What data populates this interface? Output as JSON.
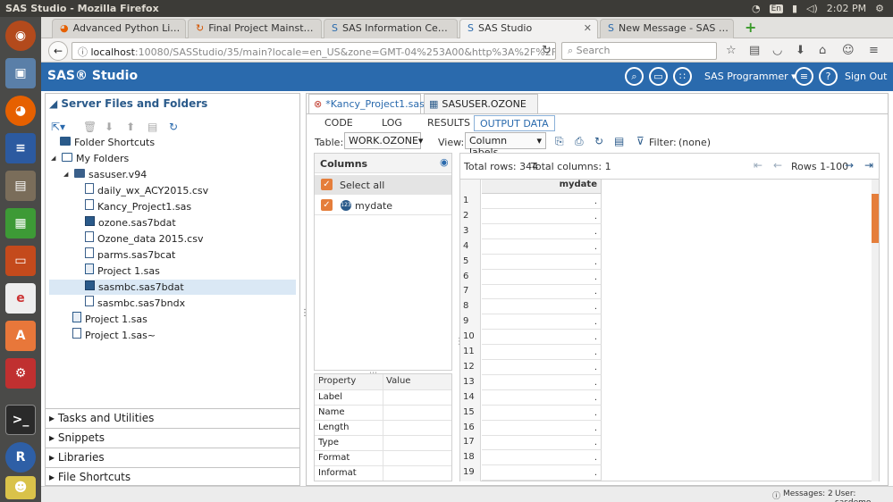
{
  "system": {
    "window_title": "SAS Studio - Mozilla Firefox",
    "keyboard": "En",
    "time": "2:02 PM"
  },
  "browser": {
    "tabs": [
      {
        "label": "Advanced Python Li…",
        "icon": "firefox-tab-icon"
      },
      {
        "label": "Final Project Mainst…",
        "icon": "refresh-tab-icon"
      },
      {
        "label": "SAS Information Ce…",
        "icon": "sas-tab-icon"
      },
      {
        "label": "SAS Studio",
        "icon": "sas-tab-icon"
      },
      {
        "label": "New Message - SAS …",
        "icon": "sas-tab-icon"
      }
    ],
    "url_host": "localhost",
    "url_rest": ":10080/SASStudio/35/main?locale=en_US&zone=GMT-04%253A00&http%3A%2F%2Flocal",
    "search_placeholder": "Search"
  },
  "sas_header": {
    "logo": "SAS® Studio",
    "role": "SAS Programmer ▾",
    "sign_out": "Sign Out"
  },
  "left": {
    "title": "Server Files and Folders",
    "tree": [
      {
        "label": "Folder Shortcuts",
        "icon": "folder-shortcuts-icon",
        "depth": 0
      },
      {
        "label": "My Folders",
        "icon": "my-folders-icon",
        "depth": 0
      },
      {
        "label": "sasuser.v94",
        "icon": "folder-icon",
        "depth": 1
      },
      {
        "label": "daily_wx_ACY2015.csv",
        "icon": "document-icon",
        "depth": 2
      },
      {
        "label": "Kancy_Project1.sas",
        "icon": "document-icon",
        "depth": 2
      },
      {
        "label": "ozone.sas7bdat",
        "icon": "dataset-icon",
        "depth": 2
      },
      {
        "label": "Ozone_data 2015.csv",
        "icon": "document-icon",
        "depth": 2
      },
      {
        "label": "parms.sas7bcat",
        "icon": "document-icon",
        "depth": 2
      },
      {
        "label": "Project 1.sas",
        "icon": "program-icon",
        "depth": 2
      },
      {
        "label": "sasmbc.sas7bdat",
        "icon": "dataset-icon",
        "depth": 2
      },
      {
        "label": "sasmbc.sas7bndx",
        "icon": "document-icon",
        "depth": 2
      },
      {
        "label": "Project 1.sas",
        "icon": "program-icon",
        "depth": 1
      },
      {
        "label": "Project 1.sas~",
        "icon": "document-icon",
        "depth": 1
      }
    ],
    "sections": [
      "Tasks and Utilities",
      "Snippets",
      "Libraries",
      "File Shortcuts"
    ]
  },
  "right": {
    "editor_tabs": [
      "*Kancy_Project1.sas",
      "SASUSER.OZONE"
    ],
    "sub_tabs": [
      "CODE",
      "LOG",
      "RESULTS",
      "OUTPUT DATA"
    ],
    "table_label": "Table:",
    "table_value": "WORK.OZONE",
    "view_label": "View:",
    "view_value": "Column labels",
    "filter_label": "Filter:",
    "filter_value": "(none)",
    "columns_title": "Columns",
    "columns": [
      "Select all",
      "mydate"
    ],
    "properties_header": [
      "Property",
      "Value"
    ],
    "properties": [
      "Label",
      "Name",
      "Length",
      "Type",
      "Format",
      "Informat"
    ],
    "total_rows": "Total rows: 344",
    "total_columns": "Total columns: 1",
    "rows_range": "Rows 1-100",
    "grid_column": "mydate",
    "grid_rows": [
      "1",
      "2",
      "3",
      "4",
      "5",
      "6",
      "7",
      "8",
      "9",
      "10",
      "11",
      "12",
      "13",
      "14",
      "15",
      "16",
      "17",
      "18",
      "19"
    ],
    "cell_value": "."
  },
  "status": {
    "messages": "Messages: 2",
    "user": "User: sasdemo"
  }
}
